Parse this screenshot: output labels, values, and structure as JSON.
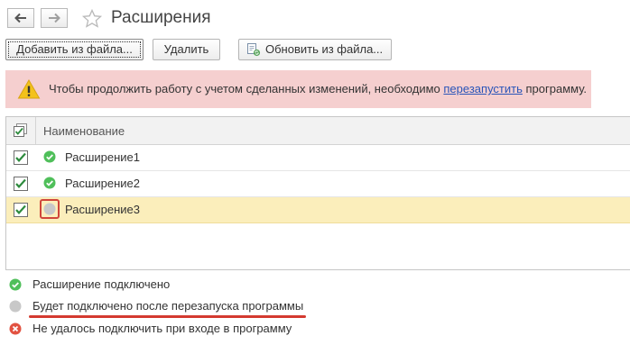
{
  "header": {
    "title": "Расширения",
    "back_icon": "arrow-left-icon",
    "forward_icon": "arrow-right-icon",
    "favorite_icon": "star-icon"
  },
  "toolbar": {
    "add_label": "Добавить из файла...",
    "delete_label": "Удалить",
    "update_label": "Обновить из файла...",
    "update_icon": "update-from-file-icon"
  },
  "banner": {
    "icon": "warning-icon",
    "text_before": "Чтобы продолжить работу с учетом сделанных изменений, необходимо ",
    "link": "перезапустить",
    "text_after": " программу."
  },
  "table": {
    "column_name": "Наименование",
    "rows": [
      {
        "name": "Расширение1",
        "checked": true,
        "status": "connected"
      },
      {
        "name": "Расширение2",
        "checked": true,
        "status": "connected"
      },
      {
        "name": "Расширение3",
        "checked": true,
        "status": "pending"
      }
    ]
  },
  "legend": [
    {
      "status": "connected",
      "text": "Расширение подключено"
    },
    {
      "status": "pending",
      "text": "Будет подключено после перезапуска программы"
    },
    {
      "status": "failed",
      "text": "Не удалось подключить при входе в программу"
    }
  ],
  "colors": {
    "connected": "#4fbf5a",
    "pending": "#c8c8c8",
    "failed": "#e25241",
    "banner_bg": "#f5cfcf",
    "selected_row": "#fbeebb",
    "link": "#2a55b8",
    "highlight": "#d0463b"
  }
}
